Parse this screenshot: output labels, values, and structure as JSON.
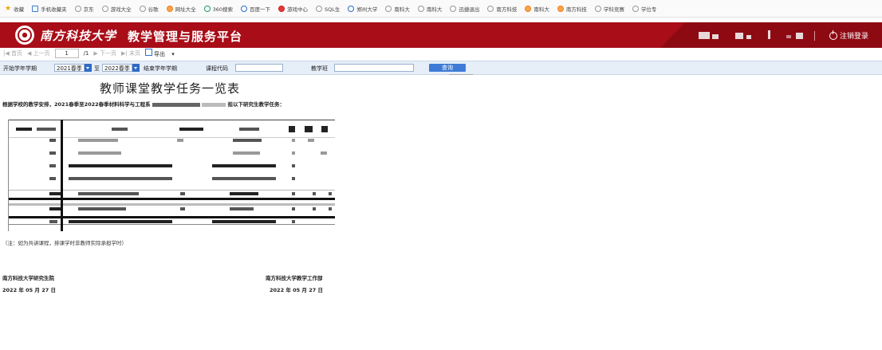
{
  "bookmarks": [
    {
      "label": "收藏",
      "icon": "star-icon"
    },
    {
      "label": "手机收藏夹",
      "icon": "folder-icon"
    },
    {
      "label": "京东",
      "icon": "globe-icon"
    },
    {
      "label": "游戏大全",
      "icon": "globe-icon"
    },
    {
      "label": "谷歌",
      "icon": "globe-icon"
    },
    {
      "label": "网址大全",
      "icon": "orange-icon"
    },
    {
      "label": "360搜索",
      "icon": "green-icon"
    },
    {
      "label": "百度一下",
      "icon": "blue-icon"
    },
    {
      "label": "游戏中心",
      "icon": "red-icon"
    },
    {
      "label": "SQL生",
      "icon": "globe-icon"
    },
    {
      "label": "郑州大学",
      "icon": "blue-icon"
    },
    {
      "label": "南科大",
      "icon": "globe-icon"
    },
    {
      "label": "南科大",
      "icon": "globe-icon"
    },
    {
      "label": "迅捷退出",
      "icon": "globe-icon"
    },
    {
      "label": "南方科技",
      "icon": "globe-icon"
    },
    {
      "label": "南科大",
      "icon": "orange-icon"
    },
    {
      "label": "南方科技",
      "icon": "orange-icon"
    },
    {
      "label": "学科竞赛",
      "icon": "globe-icon"
    },
    {
      "label": "学位专",
      "icon": "globe-icon"
    }
  ],
  "header": {
    "school_name": "南方科技大学",
    "platform_name": "教学管理与服务平台",
    "logout_label": "注销登录"
  },
  "pager": {
    "first": "|◀ 首页",
    "prev": "◀ 上一页",
    "page": "1",
    "total": "/1",
    "next": "▶ 下一页",
    "last": "▶| 末页",
    "export": "导出"
  },
  "filter": {
    "start_label": "开始学年学期",
    "start_value": "2021春季",
    "to_label": "至",
    "end_value": "2022春季",
    "end_label": "结束学年学期",
    "course_code_label": "课程代码",
    "class_label": "教学班",
    "query_button": "查询"
  },
  "report": {
    "title": "教师课堂教学任务一览表",
    "intro": "根据学校的教学安排，2021春季至2022春季材料科学与工程系",
    "intro_tail": "担以下研究生教学任务：",
    "note": "（注：如为共讲课程，排课学时非教师实际承担学时）",
    "left_signature": "南方科技大学研究生院",
    "left_date": "2022 年 05 月 27 日",
    "right_signature": "南方科技大学教学工作部",
    "right_date": "2022 年 05 月 27 日"
  },
  "colors": {
    "header_bg": "#a80d18",
    "filter_bg": "#e6eef8",
    "button_bg": "#3d7bd6"
  }
}
